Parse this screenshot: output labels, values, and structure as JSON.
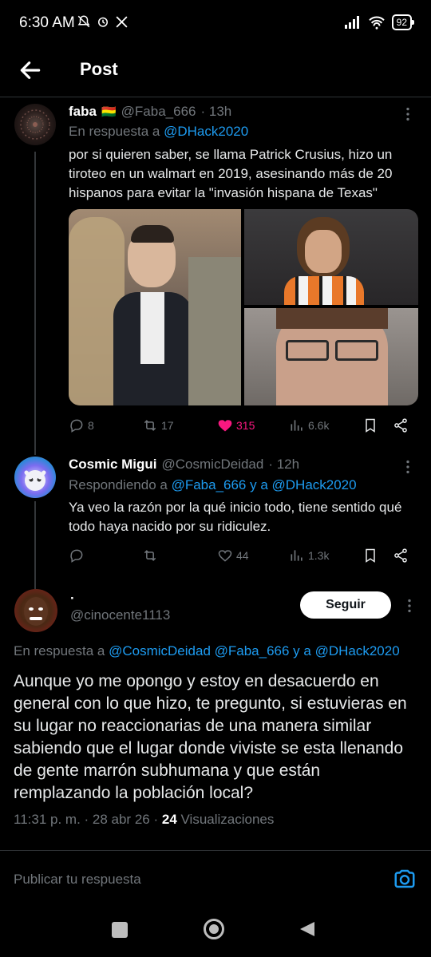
{
  "status_bar": {
    "time": "6:30 AM",
    "battery": "92"
  },
  "header": {
    "title": "Post"
  },
  "tweets": [
    {
      "name": "faba",
      "flag": "🇧🇴",
      "handle": "@Faba_666",
      "time": "· 13h",
      "reply_prefix": "En respuesta a",
      "reply_to": "@DHack2020",
      "text": "por si quieren saber, se llama Patrick Crusius, hizo un tiroteo en un walmart en 2019, asesinando más de 20 hispanos para evitar la \"invasión hispana de Texas\"",
      "stats": {
        "replies": "8",
        "retweets": "17",
        "likes": "315",
        "views": "6.6k"
      }
    },
    {
      "name": "Cosmic Migui",
      "handle": "@CosmicDeidad",
      "time": "· 12h",
      "reply_prefix": "Respondiendo a",
      "reply_to": "@Faba_666 y a @DHack2020",
      "text": "Ya veo la razón por la qué inicio todo, tiene sentido qué todo haya nacido por su ridiculez.",
      "stats": {
        "likes": "44",
        "views": "1.3k"
      }
    }
  ],
  "main_tweet": {
    "name": "·",
    "handle": "@cinocente1113",
    "follow_label": "Seguir",
    "reply_prefix": "En respuesta a",
    "reply_to": "@CosmicDeidad @Faba_666 y a @DHack2020",
    "text": "Aunque yo me opongo y estoy en desacuerdo en general con lo que hizo, te pregunto, si estuvieras en su lugar no reaccionarias de una manera similar sabiendo que el lugar donde viviste se esta llenando de gente marrón subhumana y que están remplazando la población local?",
    "timestamp": "11:31 p. m. · 28 abr 26 ·",
    "views_count": "24",
    "views_label": "Visualizaciones"
  },
  "reply_bar": {
    "placeholder": "Publicar tu respuesta"
  },
  "colors": {
    "accent": "#1d9bf0",
    "like": "#f91880",
    "muted": "#71767b"
  },
  "icons": [
    "back-arrow-icon",
    "reply-icon",
    "retweet-icon",
    "heart-icon",
    "views-icon",
    "bookmark-icon",
    "share-icon",
    "camera-icon",
    "more-icon"
  ]
}
